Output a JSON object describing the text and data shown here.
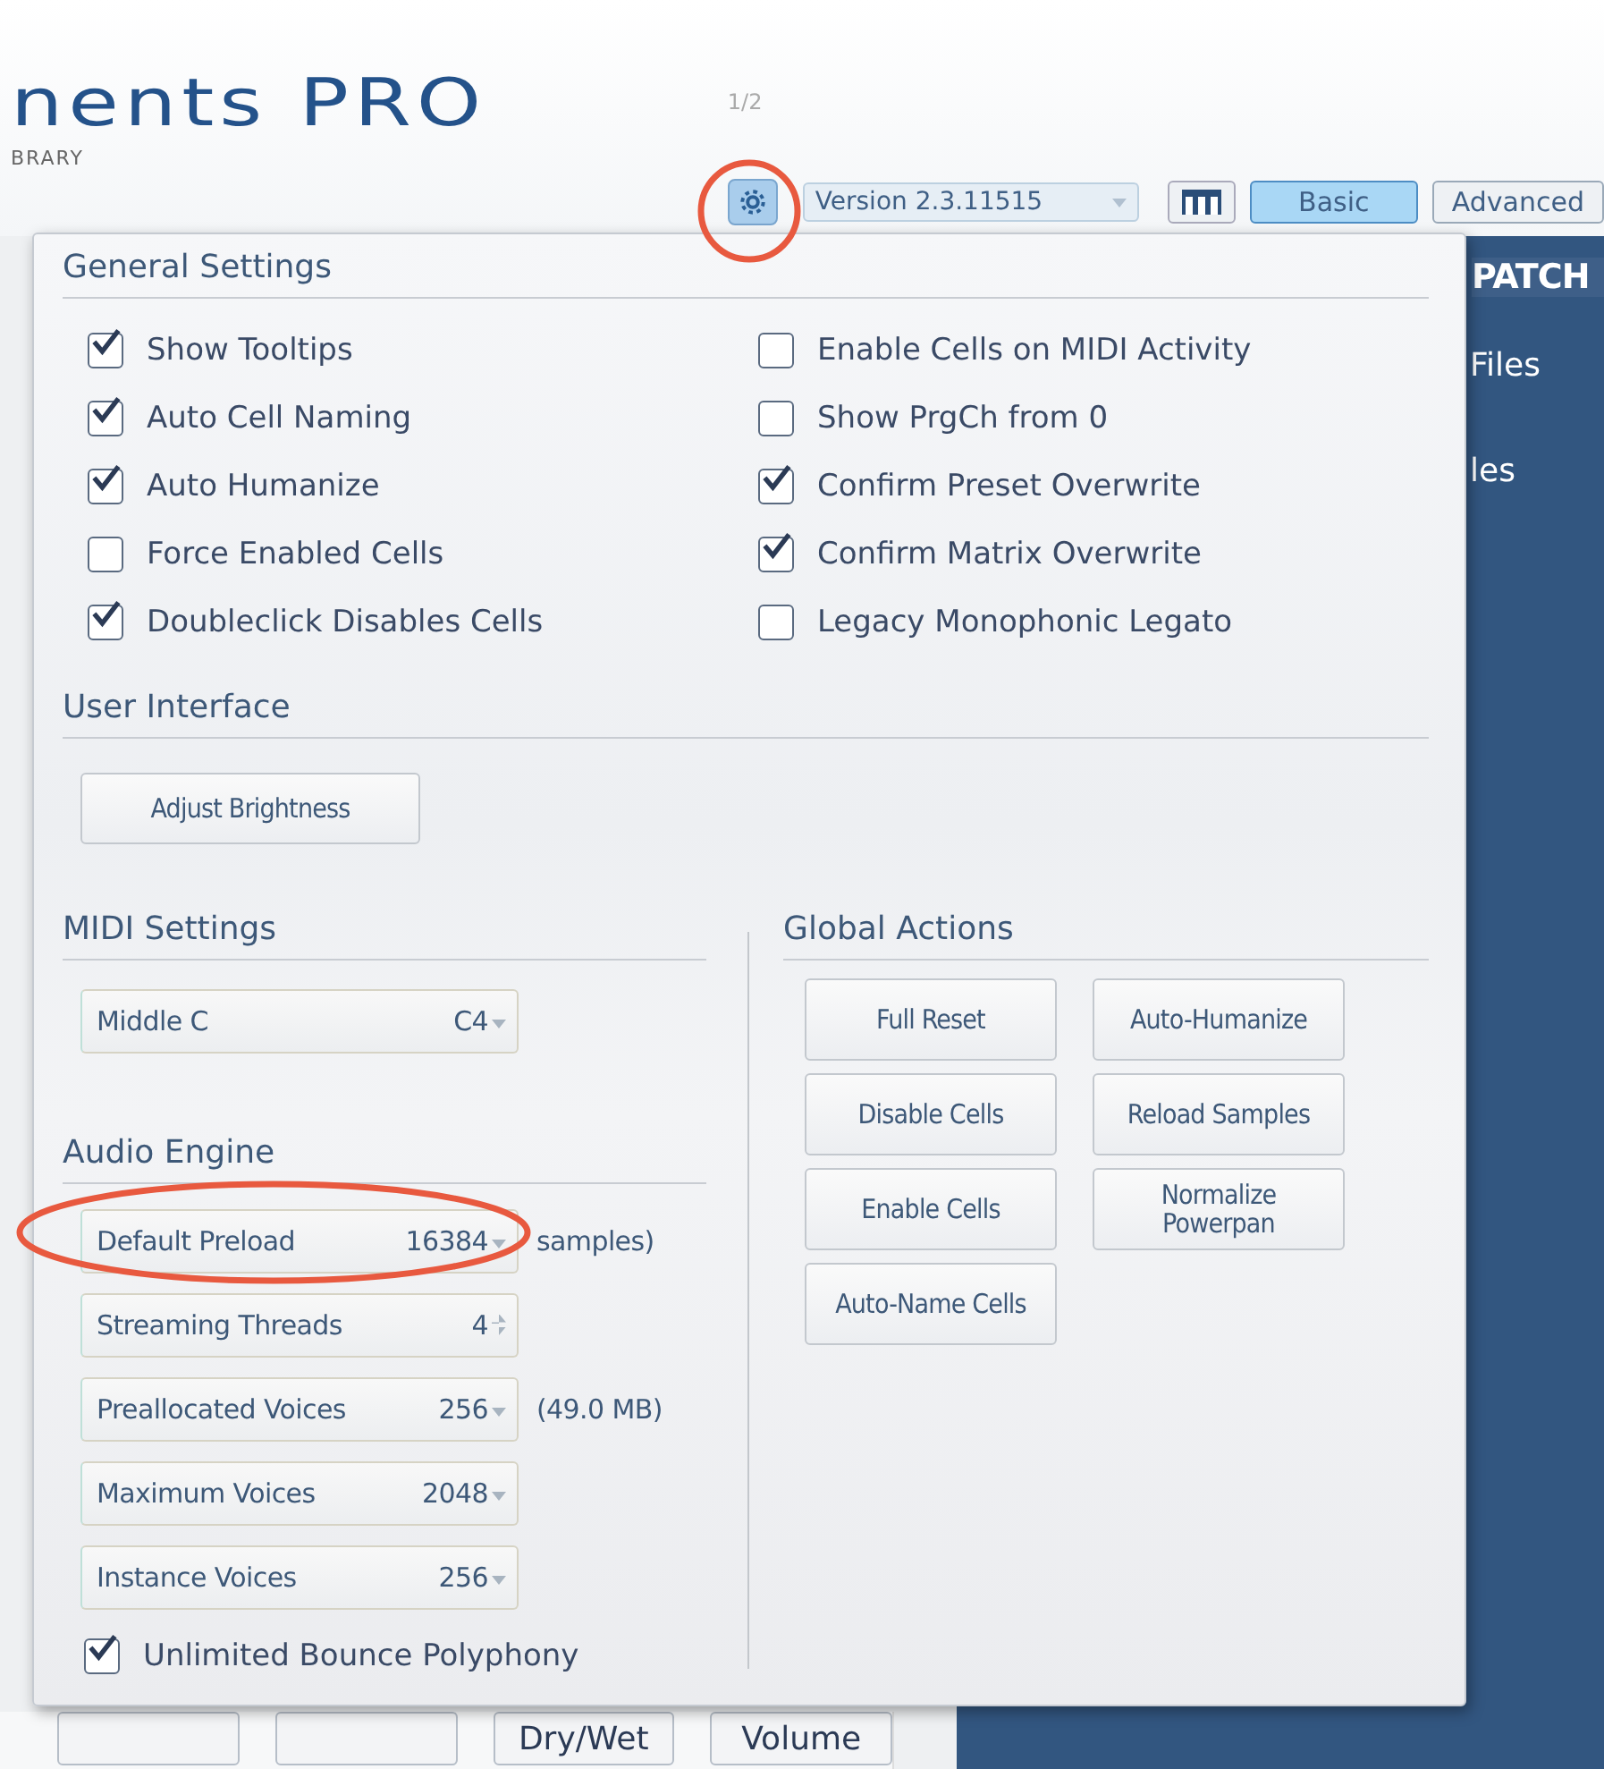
{
  "header": {
    "logo": "nents PRO",
    "subtitle": "BRARY",
    "page": "1/2",
    "version": "Version 2.3.11515",
    "modes": [
      {
        "label": "Basic",
        "selected": true
      },
      {
        "label": "Advanced",
        "selected": false
      }
    ]
  },
  "side_panel": {
    "title": "PATCH",
    "items": [
      "Files",
      "les"
    ]
  },
  "bottom_buttons": [
    {
      "label": "Dry/Wet"
    },
    {
      "label": "Volume"
    }
  ],
  "settings": {
    "general": {
      "title": "General Settings",
      "columns": [
        [
          {
            "label": "Show Tooltips",
            "checked": true
          },
          {
            "label": "Auto Cell Naming",
            "checked": true
          },
          {
            "label": "Auto Humanize",
            "checked": true
          },
          {
            "label": "Force Enabled Cells",
            "checked": false
          },
          {
            "label": "Doubleclick Disables Cells",
            "checked": true
          }
        ],
        [
          {
            "label": "Enable Cells on MIDI Activity",
            "checked": false
          },
          {
            "label": "Show PrgCh from 0",
            "checked": false
          },
          {
            "label": "Confirm Preset Overwrite",
            "checked": true
          },
          {
            "label": "Confirm Matrix Overwrite",
            "checked": true
          },
          {
            "label": "Legacy Monophonic Legato",
            "checked": false
          }
        ]
      ]
    },
    "user_interface": {
      "title": "User Interface",
      "button": "Adjust Brightness"
    },
    "midi": {
      "title": "MIDI Settings",
      "rows": [
        {
          "label": "Middle C",
          "value": "C4",
          "kind": "dropdown"
        }
      ]
    },
    "audio": {
      "title": "Audio Engine",
      "rows": [
        {
          "label": "Default Preload",
          "value": "16384",
          "kind": "dropdown",
          "note": "samples)"
        },
        {
          "label": "Streaming Threads",
          "value": "4",
          "kind": "spinner"
        },
        {
          "label": "Preallocated Voices",
          "value": "256",
          "kind": "dropdown",
          "note": "(49.0 MB)"
        },
        {
          "label": "Maximum Voices",
          "value": "2048",
          "kind": "dropdown"
        },
        {
          "label": "Instance Voices",
          "value": "256",
          "kind": "dropdown"
        }
      ],
      "checkbox": {
        "label": "Unlimited Bounce Polyphony",
        "checked": true
      }
    },
    "global": {
      "title": "Global Actions",
      "buttons": [
        "Full Reset",
        "Auto-Humanize",
        "Disable Cells",
        "Reload Samples",
        "Enable Cells",
        "Normalize Powerpan",
        "Auto-Name Cells"
      ]
    }
  }
}
